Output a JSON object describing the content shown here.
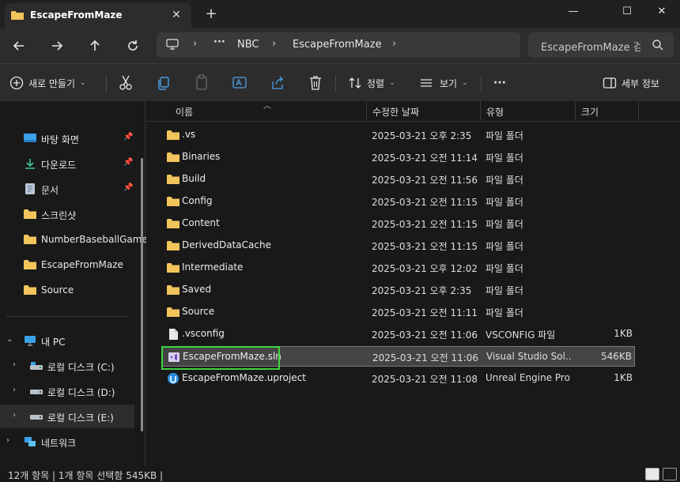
{
  "window": {
    "tab_title": "EscapeFromMaze",
    "close_tab_icon": "✕",
    "new_tab_icon": "+",
    "minimize_icon": "—",
    "maximize_icon": "☐",
    "close_icon": "✕"
  },
  "address": {
    "segments": [
      "NBC",
      "EscapeFromMaze"
    ],
    "more_icon": "···",
    "search_placeholder": "EscapeFromMaze 검"
  },
  "toolbar": {
    "new_label": "새로 만들기",
    "sort_label": "정렬",
    "view_label": "보기",
    "more_label": "···",
    "details_label": "세부 정보"
  },
  "sidebar": {
    "quick_access": [
      {
        "label": "바탕 화면",
        "icon": "desktop-icon",
        "pinned": true
      },
      {
        "label": "다운로드",
        "icon": "download-icon",
        "pinned": true
      },
      {
        "label": "문서",
        "icon": "document-icon",
        "pinned": true
      },
      {
        "label": "스크린샷",
        "icon": "folder-icon",
        "pinned": false
      },
      {
        "label": "NumberBaseballGame",
        "icon": "folder-icon",
        "pinned": false
      },
      {
        "label": "EscapeFromMaze",
        "icon": "folder-icon",
        "pinned": false
      },
      {
        "label": "Source",
        "icon": "folder-icon",
        "pinned": false
      }
    ],
    "this_pc": "내 PC",
    "drives": [
      "로컬 디스크 (C:)",
      "로컬 디스크 (D:)",
      "로컬 디스크 (E:)"
    ],
    "network": "네트워크"
  },
  "columns": {
    "name": "이름",
    "date": "수정한 날짜",
    "type": "유형",
    "size": "크기"
  },
  "files": [
    {
      "name": ".vs",
      "date": "2025-03-21 오후 2:35",
      "type": "파일 폴더",
      "size": "",
      "kind": "folder"
    },
    {
      "name": "Binaries",
      "date": "2025-03-21 오전 11:14",
      "type": "파일 폴더",
      "size": "",
      "kind": "folder"
    },
    {
      "name": "Build",
      "date": "2025-03-21 오전 11:56",
      "type": "파일 폴더",
      "size": "",
      "kind": "folder"
    },
    {
      "name": "Config",
      "date": "2025-03-21 오전 11:15",
      "type": "파일 폴더",
      "size": "",
      "kind": "folder"
    },
    {
      "name": "Content",
      "date": "2025-03-21 오전 11:15",
      "type": "파일 폴더",
      "size": "",
      "kind": "folder"
    },
    {
      "name": "DerivedDataCache",
      "date": "2025-03-21 오전 11:15",
      "type": "파일 폴더",
      "size": "",
      "kind": "folder"
    },
    {
      "name": "Intermediate",
      "date": "2025-03-21 오후 12:02",
      "type": "파일 폴더",
      "size": "",
      "kind": "folder"
    },
    {
      "name": "Saved",
      "date": "2025-03-21 오후 2:35",
      "type": "파일 폴더",
      "size": "",
      "kind": "folder"
    },
    {
      "name": "Source",
      "date": "2025-03-21 오전 11:11",
      "type": "파일 폴더",
      "size": "",
      "kind": "folder"
    },
    {
      "name": ".vsconfig",
      "date": "2025-03-21 오전 11:06",
      "type": "VSCONFIG 파일",
      "size": "1KB",
      "kind": "file"
    },
    {
      "name": "EscapeFromMaze.sln",
      "date": "2025-03-21 오전 11:06",
      "type": "Visual Studio Sol...",
      "size": "546KB",
      "kind": "sln",
      "selected": true
    },
    {
      "name": "EscapeFromMaze.uproject",
      "date": "2025-03-21 오전 11:08",
      "type": "Unreal Engine Pro...",
      "size": "1KB",
      "kind": "uproject"
    }
  ],
  "status": {
    "text": "12개 항목  |  1개 항목 선택함 545KB  |"
  },
  "colors": {
    "folder": "#f2c55c",
    "highlight": "#3fd43f",
    "selected_row": "#444444"
  }
}
